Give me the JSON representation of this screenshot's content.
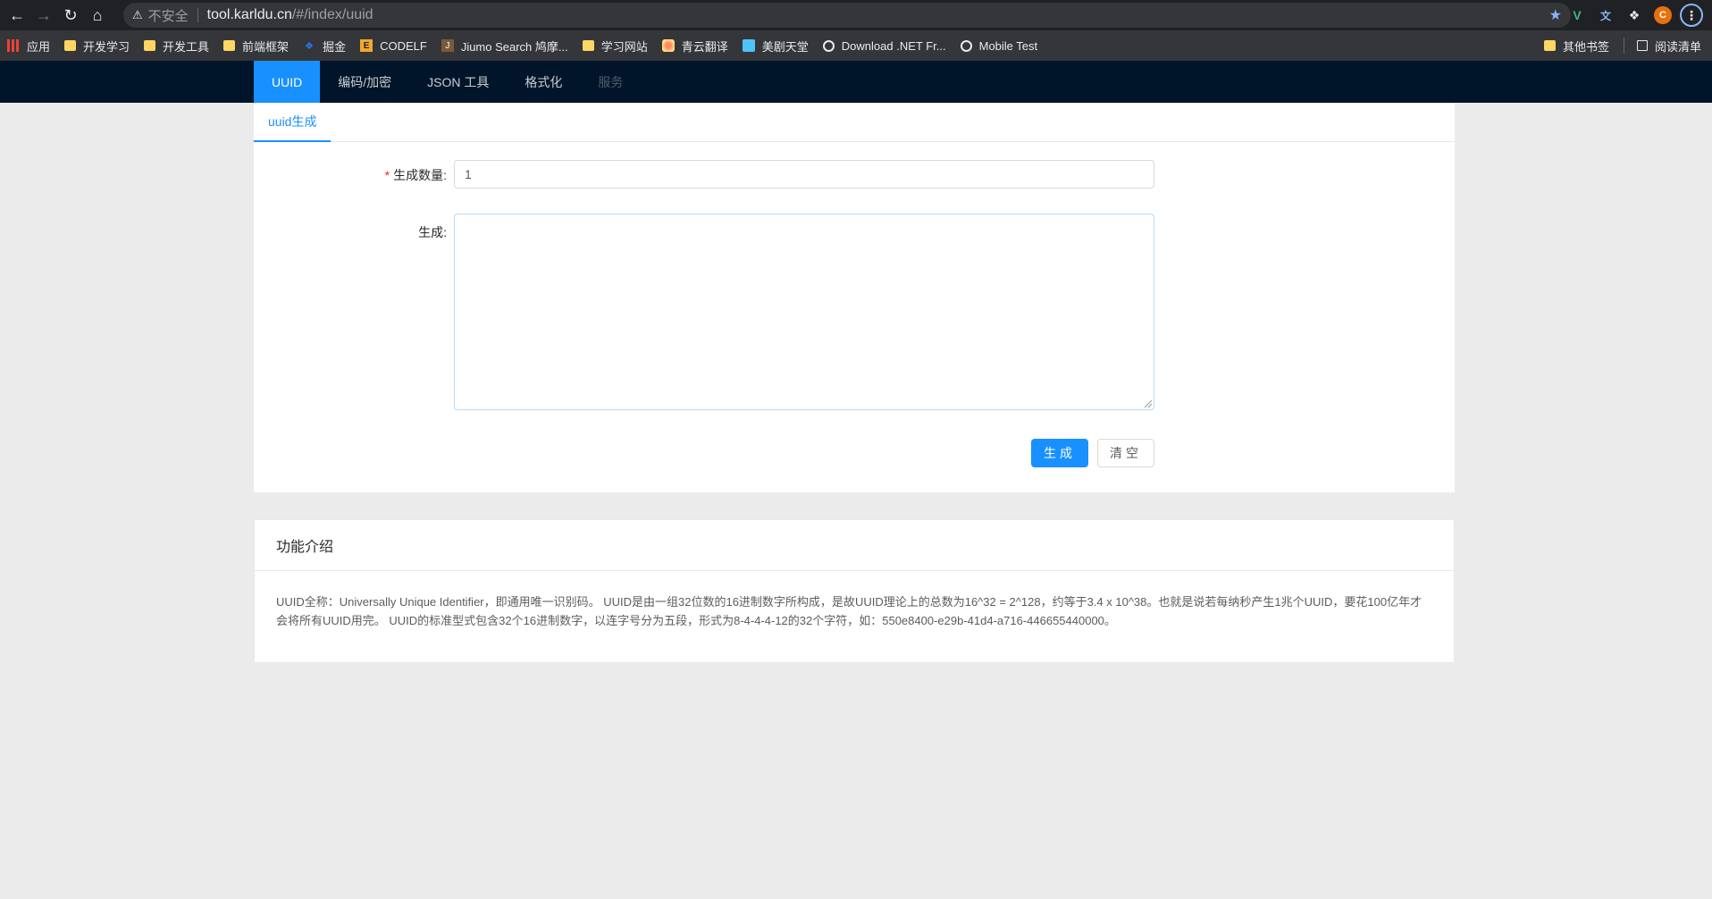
{
  "browser": {
    "insecure_label": "不安全",
    "url_host": "tool.karldu.cn",
    "url_path": "/#/index/uuid",
    "avatar_letter": "C"
  },
  "bookmarks": {
    "items": [
      {
        "label": "应用",
        "icon": "apps-icon"
      },
      {
        "label": "开发学习",
        "icon": "folder-icon"
      },
      {
        "label": "开发工具",
        "icon": "folder-icon"
      },
      {
        "label": "前端框架",
        "icon": "folder-icon"
      },
      {
        "label": "掘金",
        "icon": "juejin-icon"
      },
      {
        "label": "CODELF",
        "icon": "codelf-icon"
      },
      {
        "label": "Jiumo Search 鸠摩...",
        "icon": "jiumo-icon"
      },
      {
        "label": "学习网站",
        "icon": "folder-icon"
      },
      {
        "label": "青云翻译",
        "icon": "qingyun-icon"
      },
      {
        "label": "美剧天堂",
        "icon": "meiju-icon"
      },
      {
        "label": "Download .NET Fr...",
        "icon": "globe-icon"
      },
      {
        "label": "Mobile Test",
        "icon": "globe-icon"
      }
    ],
    "other_bookmarks": "其他书签",
    "reading_list": "阅读清单"
  },
  "header": {
    "menu": [
      {
        "label": "UUID",
        "state": "active"
      },
      {
        "label": "编码/加密",
        "state": "normal"
      },
      {
        "label": "JSON 工具",
        "state": "normal"
      },
      {
        "label": "格式化",
        "state": "normal"
      },
      {
        "label": "服务",
        "state": "disabled"
      }
    ]
  },
  "main": {
    "tab_label": "uuid生成",
    "count_label": "生成数量",
    "count_value": "1",
    "output_label": "生成",
    "generate_button": "生成",
    "clear_button": "清空"
  },
  "info": {
    "title": "功能介绍",
    "text": "UUID全称：Universally Unique Identifier，即通用唯一识别码。 UUID是由一组32位数的16进制数字所构成，是故UUID理论上的总数为16^32 = 2^128，约等于3.4 x 10^38。也就是说若每纳秒产生1兆个UUID，要花100亿年才会将所有UUID用完。 UUID的标准型式包含32个16进制数字，以连字号分为五段，形式为8-4-4-4-12的32个字符，如：550e8400-e29b-41d4-a716-446655440000。"
  },
  "colors": {
    "header_bg": "#001529",
    "accent": "#1890ff",
    "page_bg": "#ebebeb"
  }
}
